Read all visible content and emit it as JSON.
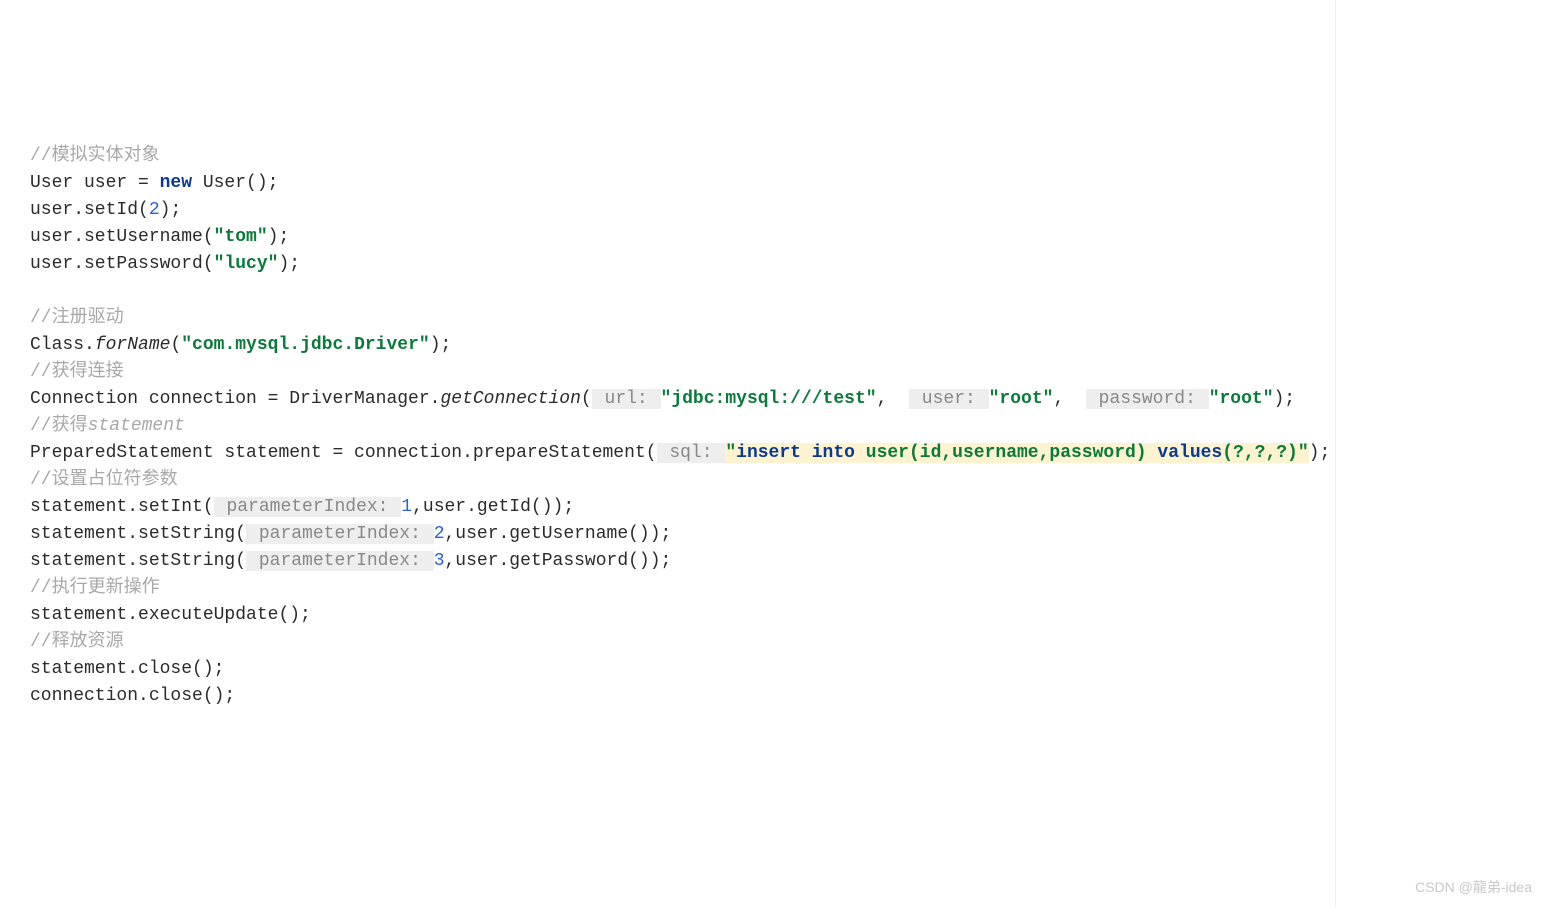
{
  "line1": {
    "c": "//模拟实体对象"
  },
  "line2": {
    "a": "User user = ",
    "kw": "new",
    "b": " User();"
  },
  "line3": {
    "a": "user.setId(",
    "n": "2",
    "b": ");"
  },
  "line4": {
    "a": "user.setUsername(",
    "s": "\"tom\"",
    "b": ");"
  },
  "line5": {
    "a": "user.setPassword(",
    "s": "\"lucy\"",
    "b": ");"
  },
  "line7": {
    "c": "//注册驱动"
  },
  "line8": {
    "a": "Class.",
    "m": "forName",
    "b": "(",
    "s": "\"com.mysql.jdbc.Driver\"",
    "c": ");"
  },
  "line9": {
    "c": "//获得连接"
  },
  "line10": {
    "a": "Connection connection = DriverManager.",
    "m": "getConnection",
    "p1": "(",
    "h1": " url: ",
    "s1": "\"jdbc:mysql:///test\"",
    "c1": ",",
    "h2": " user: ",
    "s2": "\"root\"",
    "c2": ",",
    "h3": " password: ",
    "s3": "\"root\"",
    "e": ");"
  },
  "line11": {
    "c1": "//获得",
    "c2": "statement"
  },
  "line12": {
    "a": "PreparedStatement statement = connection.prepareStatement(",
    "h": " sql: ",
    "q1": "\"",
    "k1": "insert into ",
    "t1": "user(id,username,password) ",
    "k2": "values",
    "t2": "(?,?,?)",
    "q2": "\"",
    "e": ");"
  },
  "line13": {
    "c": "//设置占位符参数"
  },
  "line14": {
    "a": "statement.setInt(",
    "h": " parameterIndex: ",
    "n": "1",
    "b": ",user.getId());"
  },
  "line15": {
    "a": "statement.setString(",
    "h": " parameterIndex: ",
    "n": "2",
    "b": ",user.getUsername());"
  },
  "line16": {
    "a": "statement.setString(",
    "h": " parameterIndex: ",
    "n": "3",
    "b": ",user.getPassword());"
  },
  "line17": {
    "c": "//执行更新操作"
  },
  "line18": {
    "a": "statement.executeUpdate();"
  },
  "line19": {
    "c": "//释放资源"
  },
  "line20": {
    "a": "statement.close();"
  },
  "line21": {
    "a": "connection.close();"
  },
  "watermark": "CSDN @龍弟-idea"
}
